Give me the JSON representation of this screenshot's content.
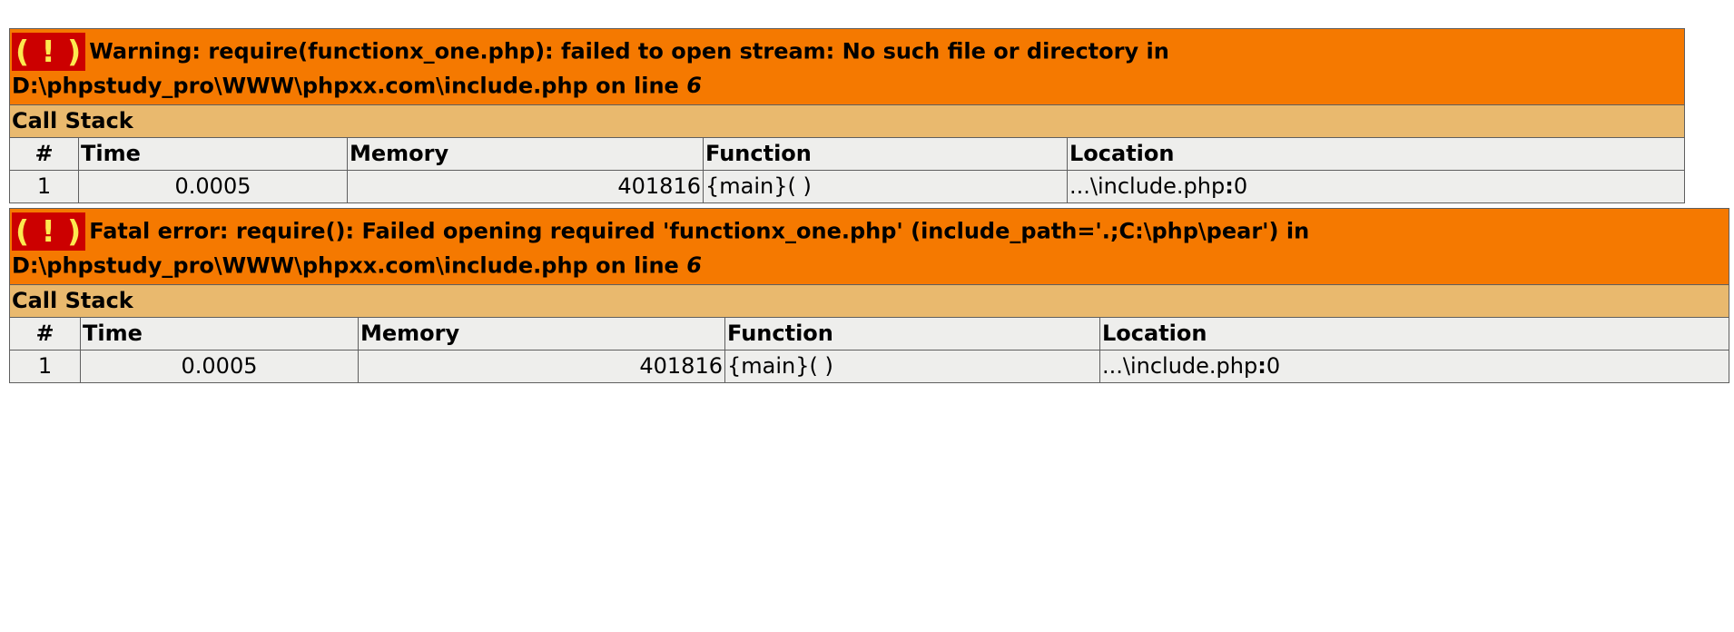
{
  "errors": [
    {
      "bang": "( ! )",
      "message": "Warning: require(functionx_one.php): failed to open stream: No such file or directory in D:\\phpstudy_pro\\WWW\\phpxx.com\\include.php on line",
      "line": "6",
      "call_stack_title": "Call Stack",
      "columns": [
        "#",
        "Time",
        "Memory",
        "Function",
        "Location"
      ],
      "rows": [
        {
          "num": "1",
          "time": "0.0005",
          "memory": "401816",
          "function": "{main}( )",
          "location_file": "...\\include.php",
          "location_sep": ":",
          "location_line": "0"
        }
      ]
    },
    {
      "bang": "( ! )",
      "message": "Fatal error: require(): Failed opening required 'functionx_one.php' (include_path='.;C:\\php\\pear') in D:\\phpstudy_pro\\WWW\\phpxx.com\\include.php on line",
      "line": "6",
      "call_stack_title": "Call Stack",
      "columns": [
        "#",
        "Time",
        "Memory",
        "Function",
        "Location"
      ],
      "rows": [
        {
          "num": "1",
          "time": "0.0005",
          "memory": "401816",
          "function": "{main}( )",
          "location_file": "...\\include.php",
          "location_sep": ":",
          "location_line": "0"
        }
      ]
    }
  ],
  "colors": {
    "message_bg": "#f57900",
    "stack_bg": "#e9b96e",
    "cell_bg": "#eeeeec",
    "bang_bg": "#cc0000",
    "bang_fg": "#fce94f"
  }
}
